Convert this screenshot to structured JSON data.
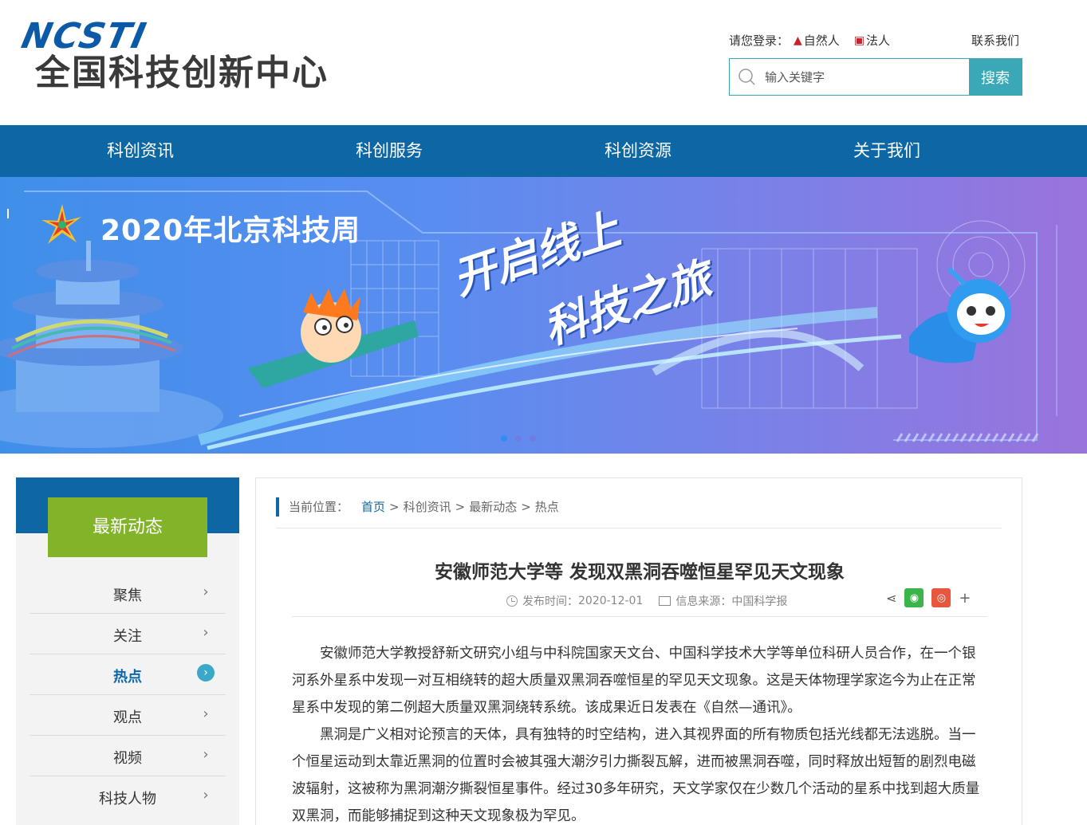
{
  "header": {
    "logo_mark": "NCSTI",
    "logo_title": "全国科技创新中心",
    "login_label": "请您登录：",
    "login_natural": "自然人",
    "login_legal": "法人",
    "contact": "联系我们",
    "search_placeholder": "输入关键字",
    "search_button": "搜索"
  },
  "nav": {
    "items": [
      "科创资讯",
      "科创服务",
      "科创资源",
      "关于我们"
    ]
  },
  "banner": {
    "title": "2020年北京科技周",
    "slogan_line1": "开启线上",
    "slogan_line2": "科技之旅",
    "slide_count": 3,
    "active_slide": 1
  },
  "sidebar": {
    "title": "最新动态",
    "items": [
      {
        "label": "聚焦"
      },
      {
        "label": "关注"
      },
      {
        "label": "热点"
      },
      {
        "label": "观点"
      },
      {
        "label": "视频"
      },
      {
        "label": "科技人物"
      }
    ],
    "active_index": 2
  },
  "breadcrumb": {
    "label": "当前位置：",
    "home": "首页",
    "level1": "科创资讯",
    "level2": "最新动态",
    "level3": "热点",
    "separator": ">"
  },
  "article": {
    "title": "安徽师范大学等 发现双黑洞吞噬恒星罕见天文现象",
    "publish_label": "发布时间：",
    "publish_date": "2020-12-01",
    "source_label": "信息来源：",
    "source": "中国科学报",
    "paragraphs": [
      "安徽师范大学教授舒新文研究小组与中科院国家天文台、中国科学技术大学等单位科研人员合作，在一个银河系外星系中发现一对互相绕转的超大质量双黑洞吞噬恒星的罕见天文现象。这是天体物理学家迄今为止在正常星系中发现的第二例超大质量双黑洞绕转系统。该成果近日发表在《自然—通讯》。",
      "黑洞是广义相对论预言的天体，具有独特的时空结构，进入其视界面的所有物质包括光线都无法逃脱。当一个恒星运动到太靠近黑洞的位置时会被其强大潮汐引力撕裂瓦解，进而被黑洞吞噬，同时释放出短暂的剧烈电磁波辐射，这被称为黑洞潮汐撕裂恒星事件。经过30多年研究，天文学家仅在少数几个活动的星系中找到超大质量双黑洞，而能够捕捉到这种天文现象极为罕见。"
    ]
  },
  "colors": {
    "brand_blue": "#0d67a5",
    "sidebar_green": "#82b42a",
    "search_teal": "#3aa8b6"
  }
}
